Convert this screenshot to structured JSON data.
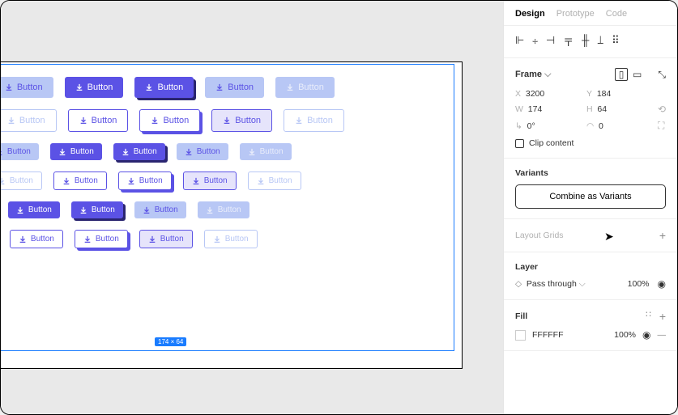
{
  "tabs": {
    "design": "Design",
    "prototype": "Prototype",
    "code": "Code"
  },
  "frame": {
    "label": "Frame",
    "x_label": "X",
    "x": "3200",
    "y_label": "Y",
    "y": "184",
    "w_label": "W",
    "w": "174",
    "h_label": "H",
    "h": "64",
    "rot_label": "⟀",
    "rot": "0°",
    "rad_label": "⌐",
    "rad": "0",
    "clip": "Clip content"
  },
  "variants": {
    "title": "Variants",
    "button": "Combine as Variants"
  },
  "layoutGrids": {
    "title": "Layout Grids"
  },
  "layer": {
    "title": "Layer",
    "blend": "Pass through",
    "opacity": "100%"
  },
  "fill": {
    "title": "Fill",
    "hex": "FFFFFF",
    "opacity": "100%"
  },
  "buttonLabel": "Button"
}
